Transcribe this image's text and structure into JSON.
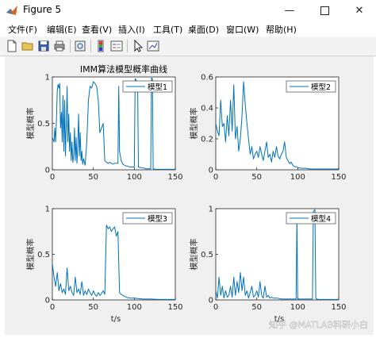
{
  "window": {
    "title": "Figure 5"
  },
  "menu": [
    {
      "label": "文件(F)"
    },
    {
      "label": "编辑(E)"
    },
    {
      "label": "查看(V)"
    },
    {
      "label": "插入(I)"
    },
    {
      "label": "工具(T)"
    },
    {
      "label": "桌面(D)"
    },
    {
      "label": "窗口(W)"
    },
    {
      "label": "帮助(H)"
    }
  ],
  "toolbar_icons": [
    "new-file-icon",
    "open-folder-icon",
    "save-icon",
    "print-icon",
    "print-preview-icon",
    "colorbar-icon",
    "legend-icon",
    "pointer-icon",
    "datacursor-icon"
  ],
  "figure": {
    "title": "IMM算法模型概率曲线",
    "watermark": "知乎 @MATLAB科研小白"
  },
  "chart_data": [
    {
      "type": "line",
      "ylabel": "模型概率",
      "legend": "模型1",
      "legend_position": "top-right",
      "xlim": [
        0,
        150
      ],
      "ylim": [
        0,
        1
      ],
      "xticks": [
        0,
        50,
        100,
        150
      ],
      "yticks": [
        0,
        0.5,
        1
      ],
      "ytick_labels": [
        "0",
        "0.5",
        "1"
      ],
      "x": [
        0,
        2,
        3,
        4,
        5,
        6,
        7,
        8,
        9,
        10,
        11,
        12,
        13,
        14,
        15,
        16,
        17,
        18,
        19,
        20,
        21,
        22,
        23,
        24,
        25,
        26,
        27,
        28,
        29,
        30,
        31,
        32,
        33,
        34,
        35,
        36,
        37,
        38,
        40,
        42,
        44,
        46,
        48,
        50,
        52,
        54,
        56,
        58,
        60,
        62,
        64,
        66,
        68,
        70,
        72,
        74,
        76,
        78,
        80,
        81,
        82,
        84,
        86,
        88,
        90,
        92,
        94,
        96,
        98,
        100,
        101,
        102,
        103,
        104,
        105,
        110,
        112,
        114,
        116,
        118,
        120,
        121,
        122,
        123,
        124,
        125,
        130,
        140,
        150
      ],
      "y": [
        0.35,
        0.3,
        0.45,
        0.3,
        0.55,
        0.85,
        0.92,
        0.88,
        0.93,
        0.45,
        0.62,
        0.3,
        0.8,
        0.2,
        0.75,
        0.15,
        0.5,
        0.9,
        0.3,
        0.6,
        0.2,
        0.4,
        0.1,
        0.3,
        0.08,
        0.15,
        0.45,
        0.1,
        0.35,
        0.07,
        0.25,
        0.6,
        0.15,
        0.4,
        0.1,
        0.2,
        0.06,
        0.12,
        0.05,
        0.3,
        0.75,
        0.9,
        0.88,
        0.95,
        0.93,
        0.9,
        0.75,
        0.4,
        0.45,
        0.5,
        0.1,
        0.08,
        0.07,
        0.08,
        0.07,
        0.06,
        0.07,
        0.07,
        0.07,
        0.9,
        0.2,
        0.1,
        0.06,
        0.05,
        0.04,
        0.04,
        0.03,
        0.03,
        0.03,
        0.03,
        0.98,
        0.97,
        0.95,
        0.9,
        0.03,
        0.02,
        0.02,
        0.01,
        0.01,
        0.01,
        0.01,
        0.99,
        0.98,
        0.01,
        0.01,
        0.005,
        0.005,
        0.005,
        0.005
      ]
    },
    {
      "type": "line",
      "ylabel": "模型概率",
      "legend": "模型2",
      "legend_position": "top-right",
      "xlim": [
        0,
        150
      ],
      "ylim": [
        0,
        0.6
      ],
      "xticks": [
        0,
        50,
        100,
        150
      ],
      "yticks": [
        0,
        0.2,
        0.4,
        0.6
      ],
      "ytick_labels": [
        "0",
        "0.2",
        "0.4",
        "0.6"
      ],
      "x": [
        0,
        2,
        4,
        6,
        8,
        10,
        12,
        14,
        16,
        18,
        20,
        22,
        24,
        26,
        28,
        30,
        32,
        34,
        36,
        38,
        40,
        42,
        44,
        46,
        48,
        50,
        52,
        54,
        56,
        58,
        60,
        62,
        64,
        66,
        68,
        70,
        72,
        74,
        76,
        78,
        80,
        82,
        84,
        86,
        88,
        90,
        92,
        94,
        96,
        98,
        100,
        105,
        110,
        115,
        120,
        130,
        140,
        150
      ],
      "y": [
        0.3,
        0.25,
        0.22,
        0.45,
        0.28,
        0.3,
        0.18,
        0.35,
        0.22,
        0.45,
        0.25,
        0.55,
        0.2,
        0.28,
        0.12,
        0.2,
        0.35,
        0.57,
        0.42,
        0.3,
        0.2,
        0.1,
        0.15,
        0.07,
        0.1,
        0.12,
        0.08,
        0.15,
        0.1,
        0.06,
        0.12,
        0.18,
        0.08,
        0.1,
        0.05,
        0.12,
        0.08,
        0.15,
        0.09,
        0.07,
        0.1,
        0.12,
        0.18,
        0.08,
        0.06,
        0.04,
        0.05,
        0.03,
        0.02,
        0.02,
        0.015,
        0.01,
        0.01,
        0.005,
        0.005,
        0.005,
        0.005,
        0.005
      ]
    },
    {
      "type": "line",
      "ylabel": "模型概率",
      "legend": "模型3",
      "legend_position": "top-right",
      "xlim": [
        0,
        150
      ],
      "ylim": [
        0,
        1
      ],
      "xticks": [
        0,
        50,
        100,
        150
      ],
      "yticks": [
        0,
        0.5,
        1
      ],
      "ytick_labels": [
        "0",
        "0.5",
        "1"
      ],
      "x": [
        0,
        2,
        4,
        6,
        8,
        10,
        12,
        14,
        16,
        18,
        20,
        22,
        24,
        26,
        28,
        30,
        32,
        34,
        36,
        38,
        40,
        42,
        44,
        46,
        48,
        50,
        52,
        54,
        56,
        58,
        60,
        62,
        64,
        66,
        68,
        70,
        72,
        74,
        76,
        78,
        80,
        82,
        84,
        86,
        88,
        90,
        95,
        100,
        110,
        120,
        130,
        140,
        150
      ],
      "y": [
        0.4,
        0.25,
        0.15,
        0.3,
        0.1,
        0.18,
        0.08,
        0.12,
        0.06,
        0.35,
        0.1,
        0.15,
        0.08,
        0.05,
        0.25,
        0.08,
        0.12,
        0.06,
        0.2,
        0.05,
        0.1,
        0.06,
        0.12,
        0.08,
        0.05,
        0.1,
        0.06,
        0.04,
        0.08,
        0.05,
        0.07,
        0.1,
        0.06,
        0.82,
        0.78,
        0.8,
        0.75,
        0.78,
        0.8,
        0.7,
        0.75,
        0.08,
        0.06,
        0.05,
        0.04,
        0.03,
        0.02,
        0.02,
        0.01,
        0.01,
        0.005,
        0.005,
        0.005
      ]
    },
    {
      "type": "line",
      "ylabel": "模型概率",
      "legend": "模型4",
      "legend_position": "top-right",
      "xlim": [
        0,
        150
      ],
      "ylim": [
        0,
        1
      ],
      "xticks": [
        0,
        50,
        100,
        150
      ],
      "yticks": [
        0,
        0.5,
        1
      ],
      "ytick_labels": [
        "0",
        "0.5",
        "1"
      ],
      "x": [
        0,
        2,
        4,
        6,
        8,
        10,
        12,
        14,
        16,
        18,
        20,
        22,
        24,
        26,
        28,
        30,
        32,
        34,
        36,
        38,
        40,
        42,
        44,
        46,
        48,
        50,
        52,
        54,
        56,
        58,
        60,
        62,
        64,
        66,
        68,
        70,
        75,
        80,
        85,
        90,
        95,
        98,
        99,
        100,
        101,
        102,
        110,
        118,
        119,
        120,
        121,
        122,
        123,
        124,
        125,
        130,
        140,
        150
      ],
      "y": [
        0.1,
        0.02,
        0.25,
        0.05,
        0.15,
        0.02,
        0.1,
        0.03,
        0.05,
        0.15,
        0.03,
        0.25,
        0.05,
        0.2,
        0.08,
        0.3,
        0.1,
        0.25,
        0.05,
        0.1,
        0.02,
        0.08,
        0.15,
        0.03,
        0.05,
        0.1,
        0.03,
        0.2,
        0.05,
        0.02,
        0.15,
        0.03,
        0.05,
        0.02,
        0.03,
        0.02,
        0.02,
        0.01,
        0.01,
        0.01,
        0.01,
        0.01,
        0.9,
        0.02,
        0.01,
        0.01,
        0.01,
        0.01,
        0.97,
        0.98,
        0.99,
        0.02,
        0.01,
        0.01,
        0.005,
        0.005,
        0.005,
        0.005
      ]
    }
  ],
  "xlabel_bottom": "t/s"
}
